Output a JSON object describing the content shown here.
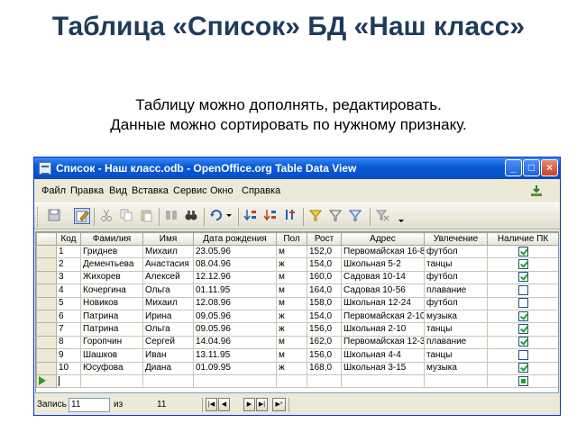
{
  "slide": {
    "title": "Таблица «Список»  БД «Наш класс»",
    "subtitle_line1": "Таблицу можно дополнять, редактировать.",
    "subtitle_line2": "Данные можно сортировать по нужному признаку."
  },
  "window": {
    "title": "Список - Наш класс.odb - OpenOffice.org Table Data View",
    "buttons": {
      "minimize": "_",
      "maximize": "□",
      "close": "×"
    }
  },
  "menu": {
    "items": [
      "Файл",
      "Правка",
      "Вид",
      "Вставка",
      "Сервис",
      "Окно",
      "Справка"
    ]
  },
  "toolbar": {
    "icons": [
      "save-icon",
      "edit-icon",
      "cut-icon",
      "copy-icon",
      "paste-icon",
      "find-icon",
      "binoculars-icon",
      "refresh-icon",
      "sort-ascending-icon",
      "sort-descending-icon",
      "sort-icon",
      "autofilter-icon",
      "filter-icon",
      "standard-filter-icon",
      "remove-filter-icon"
    ]
  },
  "grid": {
    "columns": [
      "Код",
      "Фамилия",
      "Имя",
      "Дата рождения",
      "Пол",
      "Рост",
      "Адрес",
      "Увлечение",
      "Наличие ПК"
    ],
    "rows": [
      {
        "id": "1",
        "last": "Гриднев",
        "first": "Михаил",
        "dob": "23.05.96",
        "sex": "м",
        "height": "152,0",
        "address": "Первомайская 16-8",
        "hobby": "футбол",
        "pc": true
      },
      {
        "id": "2",
        "last": "Дементьева",
        "first": "Анастасия",
        "dob": "08.04.96",
        "sex": "ж",
        "height": "154,0",
        "address": "Школьная 5-2",
        "hobby": "танцы",
        "pc": true
      },
      {
        "id": "3",
        "last": "Жихорев",
        "first": "Алексей",
        "dob": "12.12.96",
        "sex": "м",
        "height": "160,0",
        "address": "Садовая 10-14",
        "hobby": "футбол",
        "pc": true
      },
      {
        "id": "4",
        "last": "Кочергина",
        "first": "Ольга",
        "dob": "01.11.95",
        "sex": "м",
        "height": "164,0",
        "address": "Садовая 10-56",
        "hobby": "плавание",
        "pc": false
      },
      {
        "id": "5",
        "last": "Новиков",
        "first": "Михаил",
        "dob": "12.08.96",
        "sex": "м",
        "height": "158,0",
        "address": "Школьная 12-24",
        "hobby": "футбол",
        "pc": false
      },
      {
        "id": "6",
        "last": "Патрина",
        "first": "Ирина",
        "dob": "09.05.96",
        "sex": "ж",
        "height": "154,0",
        "address": "Первомайская 2-10",
        "hobby": "музыка",
        "pc": true
      },
      {
        "id": "7",
        "last": "Патрина",
        "first": "Ольга",
        "dob": "09.05.96",
        "sex": "ж",
        "height": "156,0",
        "address": "Школьная 2-10",
        "hobby": "танцы",
        "pc": true
      },
      {
        "id": "8",
        "last": "Горопчин",
        "first": "Сергей",
        "dob": "14.04.96",
        "sex": "м",
        "height": "162,0",
        "address": "Первомайская 12-3",
        "hobby": "плавание",
        "pc": true
      },
      {
        "id": "9",
        "last": "Шашков",
        "first": "Иван",
        "dob": "13.11.95",
        "sex": "м",
        "height": "156,0",
        "address": "Школьная 4-4",
        "hobby": "танцы",
        "pc": false
      },
      {
        "id": "10",
        "last": "Юсуфова",
        "first": "Диана",
        "dob": "01.09.95",
        "sex": "ж",
        "height": "168,0",
        "address": "Школьная 3-15",
        "hobby": "музыка",
        "pc": true
      }
    ]
  },
  "status": {
    "record_label": "Запись",
    "record_value": "11",
    "of_label": "из",
    "total": "11",
    "nav": {
      "first": "|◀",
      "prev": "◀",
      "next": "▶",
      "last": "▶|",
      "new": "▶*"
    }
  },
  "colors": {
    "title": "#1f3b5c",
    "titlebar": "#0a5bd8",
    "check": "#21a121"
  }
}
